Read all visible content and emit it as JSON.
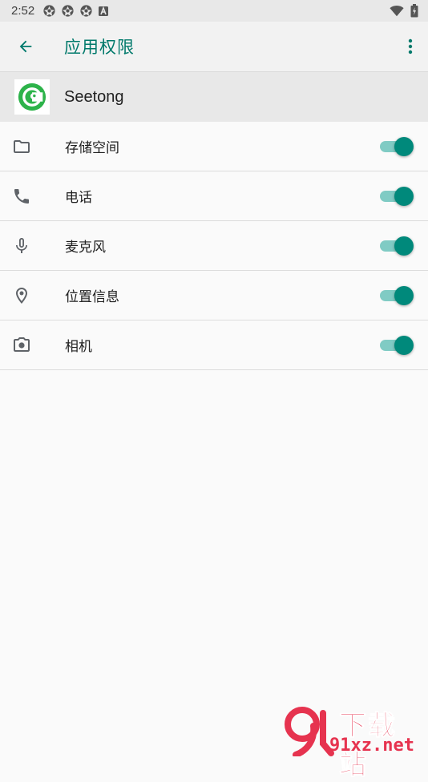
{
  "status_bar": {
    "time": "2:52",
    "notification_icons": [
      "aperture-icon",
      "aperture-icon",
      "aperture-icon",
      "a-badge-icon"
    ],
    "right_icons": [
      "wifi-icon",
      "battery-icon"
    ]
  },
  "app_bar": {
    "title": "应用权限",
    "back_icon": "arrow-left-icon",
    "menu_icon": "more-vert-icon",
    "accent_color": "#00796b"
  },
  "app": {
    "name": "Seetong",
    "logo_icon": "seetong-logo-icon"
  },
  "permissions": [
    {
      "label": "存储空间",
      "icon": "folder-icon",
      "enabled": true
    },
    {
      "label": "电话",
      "icon": "phone-icon",
      "enabled": true
    },
    {
      "label": "麦克风",
      "icon": "microphone-icon",
      "enabled": true
    },
    {
      "label": "位置信息",
      "icon": "location-pin-icon",
      "enabled": true
    },
    {
      "label": "相机",
      "icon": "camera-icon",
      "enabled": true
    }
  ],
  "colors": {
    "toggle_on_thumb": "#00897b",
    "toggle_on_track": "#80cbc4",
    "watermark": "#e6334f"
  },
  "watermark": {
    "title": "下载站",
    "url": "91xz.net"
  }
}
